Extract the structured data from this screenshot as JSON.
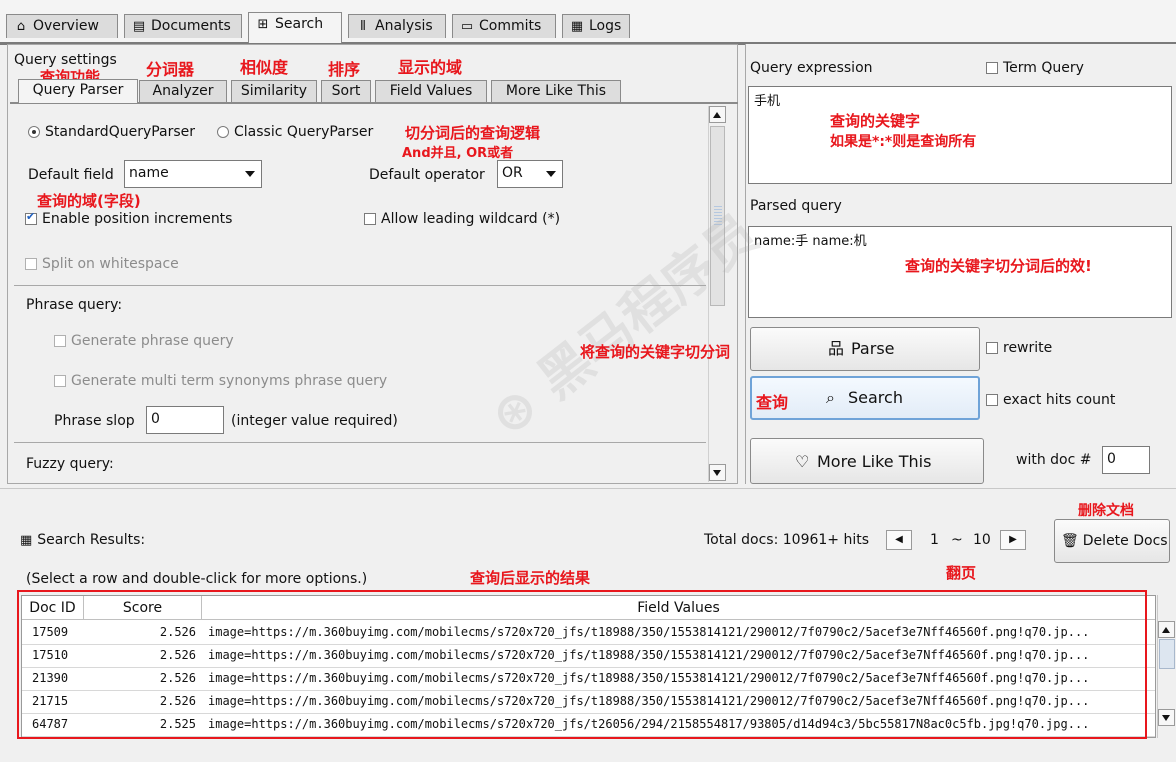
{
  "top_tabs": [
    {
      "icon": "⌂",
      "label": "Overview"
    },
    {
      "icon": "▤",
      "label": "Documents"
    },
    {
      "icon": "⊞",
      "label": "Search",
      "active": true
    },
    {
      "icon": "⫴",
      "label": "Analysis"
    },
    {
      "icon": "▭",
      "label": "Commits"
    },
    {
      "icon": "▦",
      "label": "Logs"
    }
  ],
  "query_settings": {
    "title": "Query settings",
    "tabs": [
      "Query Parser",
      "Analyzer",
      "Similarity",
      "Sort",
      "Field Values",
      "More Like This"
    ],
    "parser_standard": "StandardQueryParser",
    "parser_classic": "Classic QueryParser",
    "default_field_label": "Default field",
    "default_field_value": "name",
    "default_operator_label": "Default operator",
    "default_operator_value": "OR",
    "enable_position_increments": "Enable position increments",
    "allow_leading_wildcard": "Allow leading wildcard (*)",
    "split_on_whitespace": "Split on whitespace",
    "phrase_query_heading": "Phrase query:",
    "generate_phrase_query": "Generate phrase query",
    "generate_multi_term": "Generate multi term synonyms phrase query",
    "phrase_slop_label": "Phrase slop",
    "phrase_slop_value": "0",
    "phrase_slop_hint": "(integer value required)",
    "fuzzy_query_heading": "Fuzzy query:"
  },
  "right_panel": {
    "query_expression_label": "Query expression",
    "term_query_label": "Term Query",
    "query_expression_value": "手机",
    "parsed_query_label": "Parsed query",
    "parsed_query_value": "name:手 name:机",
    "parse_button": "Parse",
    "rewrite_label": "rewrite",
    "search_button": "Search",
    "exact_hits_label": "exact hits count",
    "mlt_button": "More Like This",
    "with_doc_label": "with doc #",
    "with_doc_value": "0"
  },
  "results": {
    "title": "Search Results:",
    "hint": "(Select a row and double-click for more options.)",
    "total_docs": "Total docs: 10961+ hits",
    "page_from": "1",
    "page_sep": "~",
    "page_to": "10",
    "delete_docs": "Delete Docs",
    "columns": [
      "Doc ID",
      "Score",
      "Field Values"
    ],
    "rows": [
      {
        "id": "17509",
        "score": "2.526",
        "values": "image=https://m.360buyimg.com/mobilecms/s720x720_jfs/t18988/350/1553814121/290012/7f0790c2/5acef3e7Nff46560f.png!q70.jp..."
      },
      {
        "id": "17510",
        "score": "2.526",
        "values": "image=https://m.360buyimg.com/mobilecms/s720x720_jfs/t18988/350/1553814121/290012/7f0790c2/5acef3e7Nff46560f.png!q70.jp..."
      },
      {
        "id": "21390",
        "score": "2.526",
        "values": "image=https://m.360buyimg.com/mobilecms/s720x720_jfs/t18988/350/1553814121/290012/7f0790c2/5acef3e7Nff46560f.png!q70.jp..."
      },
      {
        "id": "21715",
        "score": "2.526",
        "values": "image=https://m.360buyimg.com/mobilecms/s720x720_jfs/t18988/350/1553814121/290012/7f0790c2/5acef3e7Nff46560f.png!q70.jp..."
      },
      {
        "id": "64787",
        "score": "2.525",
        "values": "image=https://m.360buyimg.com/mobilecms/s720x720_jfs/t26056/294/2158554817/93805/d14d94c3/5bc55817N8ac0c5fb.jpg!q70.jpg..."
      }
    ]
  },
  "annotations": {
    "query_function": "查询功能",
    "analyzer": "分词器",
    "similarity": "相似度",
    "sort": "排序",
    "field_values": "显示的域",
    "logic_line1": "切分词后的查询逻辑",
    "logic_line2": "And并且, OR或者",
    "query_field": "查询的域(字段)",
    "keyword_line1": "查询的关键字",
    "keyword_line2": "如果是*:*则是查询所有",
    "parsed_effect": "查询的关键字切分词后的效!",
    "split_keyword": "将查询的关键字切分词",
    "search_cn": "查询",
    "delete_doc": "删除文档",
    "paging": "翻页",
    "result_display": "查询后显示的结果"
  },
  "colors": {
    "annotation": "#e8171d",
    "focus_border": "#6fa3d8"
  }
}
